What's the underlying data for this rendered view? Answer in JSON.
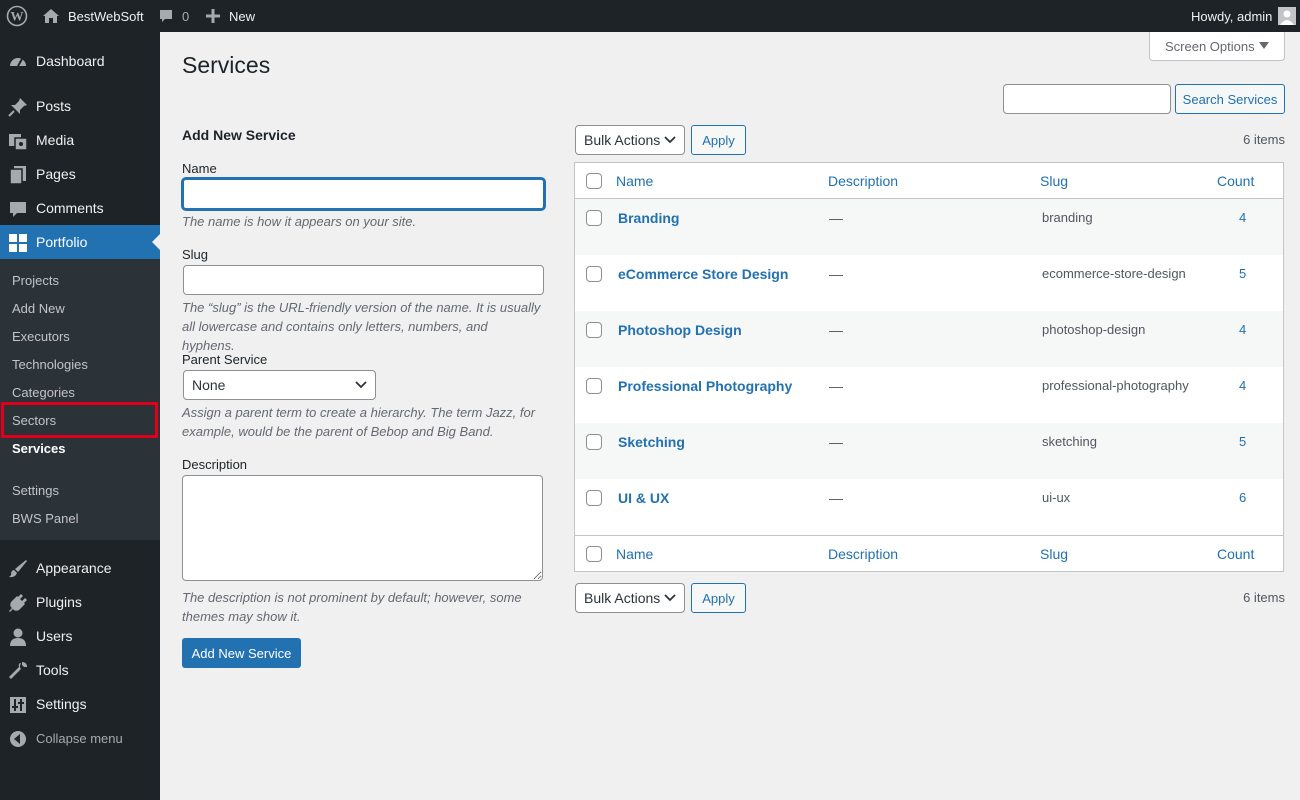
{
  "adminbar": {
    "site_name": "BestWebSoft",
    "comments_count": "0",
    "new_label": "New",
    "howdy": "Howdy, admin"
  },
  "sidebar": {
    "items": [
      {
        "label": "Dashboard",
        "icon": "dashboard-icon"
      },
      {
        "label": "Posts",
        "icon": "pin-icon"
      },
      {
        "label": "Media",
        "icon": "media-icon"
      },
      {
        "label": "Pages",
        "icon": "pages-icon"
      },
      {
        "label": "Comments",
        "icon": "comment-icon"
      },
      {
        "label": "Portfolio",
        "icon": "grid-icon",
        "active": true
      }
    ],
    "submenu": [
      "Projects",
      "Add New",
      "Executors",
      "Technologies",
      "Categories",
      "Sectors",
      "Services",
      "Settings",
      "BWS Panel"
    ],
    "current_submenu": "Services",
    "bottom_items": [
      {
        "label": "Appearance",
        "icon": "brush-icon"
      },
      {
        "label": "Plugins",
        "icon": "plugin-icon"
      },
      {
        "label": "Users",
        "icon": "user-icon"
      },
      {
        "label": "Tools",
        "icon": "wrench-icon"
      },
      {
        "label": "Settings",
        "icon": "settings-icon"
      }
    ],
    "collapse_label": "Collapse menu"
  },
  "colors": {
    "accent": "#2271b1",
    "bar": "#1d2327",
    "highlight": "#e0001b"
  },
  "screen_options": "Screen Options",
  "page_title": "Services",
  "search": {
    "button": "Search Services",
    "value": ""
  },
  "form": {
    "heading": "Add New Service",
    "name_label": "Name",
    "name_hint": "The name is how it appears on your site.",
    "slug_label": "Slug",
    "slug_hint": "The “slug” is the URL-friendly version of the name. It is usually all lowercase and contains only letters, numbers, and hyphens.",
    "parent_label": "Parent Service",
    "parent_value": "None",
    "parent_hint": "Assign a parent term to create a hierarchy. The term Jazz, for example, would be the parent of Bebop and Big Band.",
    "description_label": "Description",
    "description_hint": "The description is not prominent by default; however, some themes may show it.",
    "submit": "Add New Service"
  },
  "bulk": {
    "label": "Bulk Actions",
    "apply": "Apply",
    "items_count": "6 items"
  },
  "table": {
    "headers": {
      "name": "Name",
      "description": "Description",
      "slug": "Slug",
      "count": "Count"
    },
    "rows": [
      {
        "name": "Branding",
        "description": "—",
        "slug": "branding",
        "count": "4"
      },
      {
        "name": "eCommerce Store Design",
        "description": "—",
        "slug": "ecommerce-store-design",
        "count": "5"
      },
      {
        "name": "Photoshop Design",
        "description": "—",
        "slug": "photoshop-design",
        "count": "4"
      },
      {
        "name": "Professional Photography",
        "description": "—",
        "slug": "professional-photography",
        "count": "4"
      },
      {
        "name": "Sketching",
        "description": "—",
        "slug": "sketching",
        "count": "5"
      },
      {
        "name": "UI & UX",
        "description": "—",
        "slug": "ui-ux",
        "count": "6"
      }
    ]
  }
}
